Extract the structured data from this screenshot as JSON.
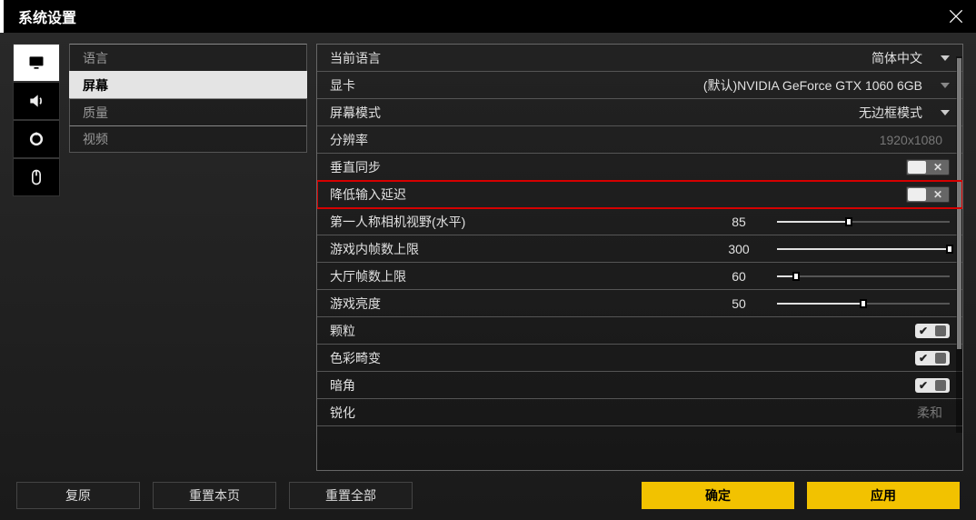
{
  "header": {
    "title": "系统设置"
  },
  "side_icons": [
    "monitor",
    "volume",
    "circle",
    "mouse"
  ],
  "selected_side_icon": 0,
  "sub_menu": {
    "items": [
      "语言",
      "屏幕",
      "质量",
      "视频"
    ],
    "selected_index": 1
  },
  "rows": [
    {
      "type": "dropdown",
      "label": "当前语言",
      "value": "简体中文",
      "valueDisabled": false
    },
    {
      "type": "dropdown",
      "label": "显卡",
      "value": "(默认)NVIDIA GeForce GTX 1060 6GB",
      "small": true
    },
    {
      "type": "dropdown",
      "label": "屏幕模式",
      "value": "无边框模式"
    },
    {
      "type": "static",
      "label": "分辨率",
      "value": "1920x1080",
      "valueDisabled": true
    },
    {
      "type": "toggle",
      "label": "垂直同步",
      "checked": false
    },
    {
      "type": "toggle",
      "label": "降低输入延迟",
      "checked": false,
      "highlight": true
    },
    {
      "type": "slider",
      "label": "第一人称相机视野(水平)",
      "value": 85,
      "min": 60,
      "max": 120
    },
    {
      "type": "slider",
      "label": "游戏内帧数上限",
      "value": 300,
      "min": 30,
      "max": 300
    },
    {
      "type": "slider",
      "label": "大厅帧数上限",
      "value": 60,
      "min": 30,
      "max": 300
    },
    {
      "type": "slider",
      "label": "游戏亮度",
      "value": 50,
      "min": 0,
      "max": 100
    },
    {
      "type": "tricheck",
      "label": "颗粒"
    },
    {
      "type": "tricheck",
      "label": "色彩畸变"
    },
    {
      "type": "tricheck",
      "label": "暗角"
    },
    {
      "type": "static",
      "label": "锐化",
      "value": "柔和",
      "valueDisabled": true
    }
  ],
  "footer": {
    "restore": "复原",
    "reset_page": "重置本页",
    "reset_all": "重置全部",
    "confirm": "确定",
    "apply": "应用"
  }
}
